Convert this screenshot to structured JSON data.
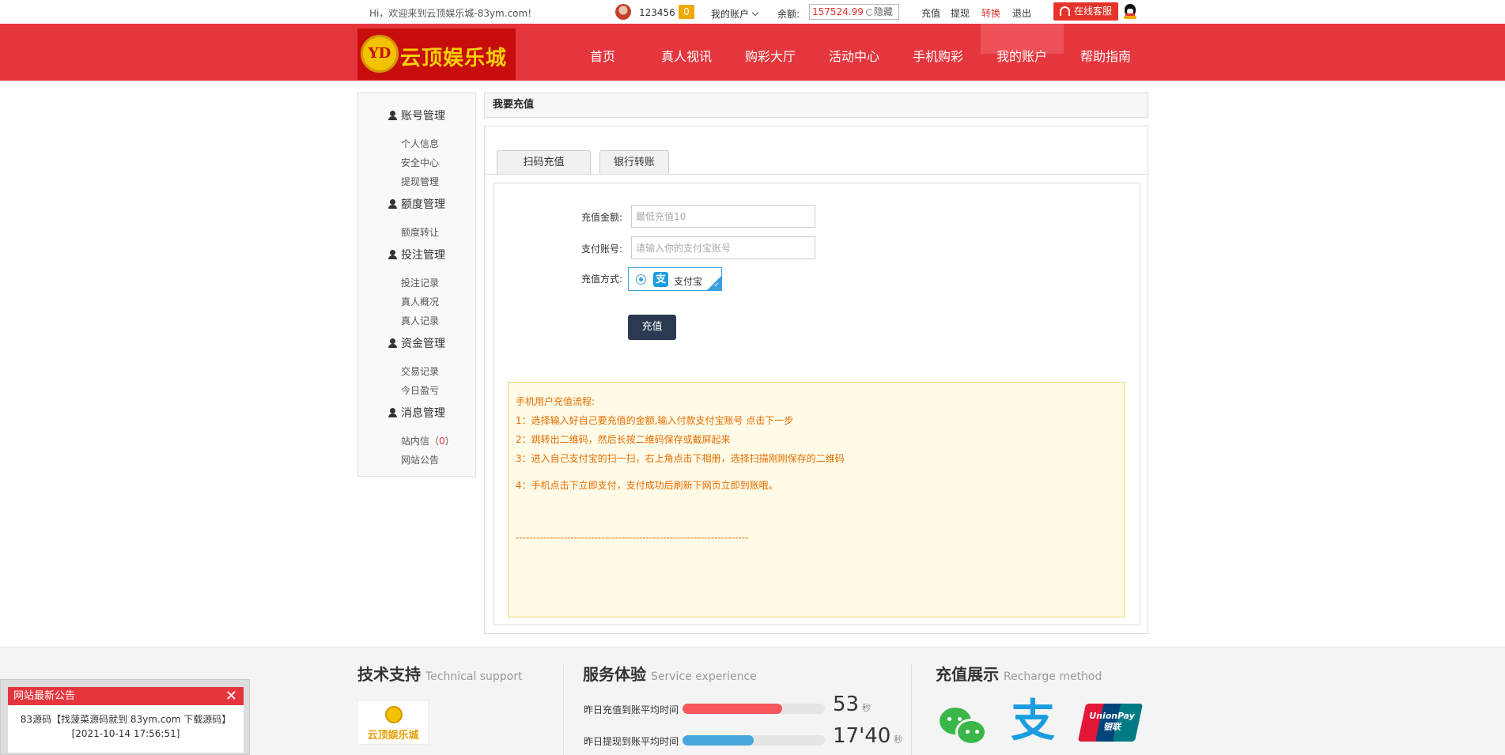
{
  "topbar": {
    "welcome": "Hi，欢迎来到云顶娱乐城-83ym.com!",
    "username": "123456",
    "msg_count": "0",
    "my_account": "我的账户",
    "balance_label": "余额:",
    "balance": "157524.99",
    "hide_label": "隐藏",
    "recharge": "充值",
    "withdraw": "提现",
    "convert": "转换",
    "logout": "退出",
    "service": "在线客服"
  },
  "nav": {
    "logo_mark": "YD",
    "logo_text": "云顶娱乐城",
    "items": [
      "首页",
      "真人视讯",
      "购彩大厅",
      "活动中心",
      "手机购彩",
      "我的账户",
      "帮助指南"
    ]
  },
  "sidebar": {
    "groups": [
      {
        "title": "账号管理",
        "items": [
          "个人信息",
          "安全中心",
          "提现管理"
        ]
      },
      {
        "title": "额度管理",
        "items": [
          "额度转让"
        ]
      },
      {
        "title": "投注管理",
        "items": [
          "投注记录",
          "真人概况",
          "真人记录"
        ]
      },
      {
        "title": "资金管理",
        "items": [
          "交易记录",
          "今日盈亏"
        ]
      },
      {
        "title": "消息管理",
        "items": [
          "站内信",
          "网站公告"
        ]
      }
    ],
    "inbox_count": "0"
  },
  "main": {
    "title": "我要充值",
    "tabs": [
      "扫码充值",
      "银行转账"
    ],
    "form": {
      "amount_label": "充值金额:",
      "amount_placeholder": "最低充值10",
      "account_label": "支付账号:",
      "account_placeholder": "请输入你的支付宝账号",
      "method_label": "充值方式:",
      "method_name": "支付宝",
      "submit": "充值"
    },
    "notice": {
      "title": "手机用户充值流程:",
      "steps": [
        "1：选择输入好自己要充值的金额,输入付款支付宝账号 点击下一步",
        "2：跳转出二维码，然后长按二维码保存或截屏起来",
        "3：进入自己支付宝的扫一扫，右上角点击下相册，选择扫描刚刚保存的二维码",
        "4：手机点击下立即支付，支付成功后刷新下网页立即到账哦。"
      ],
      "divider": "--------------------------------------------------------------------"
    }
  },
  "footer": {
    "tech_title": "技术支持",
    "tech_en": "Technical support",
    "tech_logo": "云顶娱乐城",
    "service_title": "服务体验",
    "service_en": "Service experience",
    "stats": [
      {
        "label": "昨日充值到账平均时间",
        "value": "53",
        "unit": "秒",
        "fill": 0.7,
        "color": "#f5575c"
      },
      {
        "label": "昨日提现到账平均时间",
        "value": "17'40",
        "unit": "秒",
        "fill": 0.5,
        "color": "#47a7dc"
      }
    ],
    "method_title": "充值展示",
    "method_en": "Recharge method",
    "unionpay_text": "UnionPay\n银联"
  },
  "popup": {
    "title": "网站最新公告",
    "close": "✕",
    "line1": "83源码【找菠菜源码就到 83ym.com 下载源码】",
    "line2": "[2021-10-14 17:56:51]"
  }
}
